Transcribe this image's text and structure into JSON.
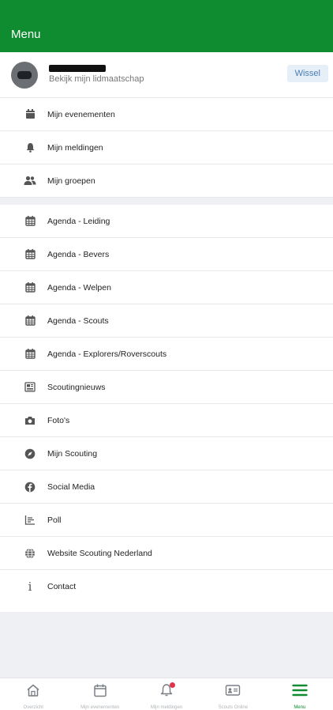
{
  "header": {
    "title": "Menu"
  },
  "member": {
    "subtitle": "Bekijk mijn lidmaatschap",
    "switch_label": "Wissel"
  },
  "group1": [
    {
      "label": "Mijn evenementen",
      "icon": "calendar-icon"
    },
    {
      "label": "Mijn meldingen",
      "icon": "bell-icon"
    },
    {
      "label": "Mijn groepen",
      "icon": "group-icon"
    }
  ],
  "group2": [
    {
      "label": "Agenda - Leiding",
      "icon": "calendar-grid-icon"
    },
    {
      "label": "Agenda - Bevers",
      "icon": "calendar-grid-icon"
    },
    {
      "label": "Agenda - Welpen",
      "icon": "calendar-grid-icon"
    },
    {
      "label": "Agenda - Scouts",
      "icon": "calendar-grid-icon"
    },
    {
      "label": "Agenda - Explorers/Roverscouts",
      "icon": "calendar-grid-icon"
    },
    {
      "label": "Scoutingnieuws",
      "icon": "newspaper-icon"
    },
    {
      "label": "Foto's",
      "icon": "camera-icon"
    },
    {
      "label": "Mijn Scouting",
      "icon": "compass-icon"
    },
    {
      "label": "Social Media",
      "icon": "facebook-icon"
    },
    {
      "label": "Poll",
      "icon": "poll-icon"
    },
    {
      "label": "Website Scouting Nederland",
      "icon": "globe-icon"
    },
    {
      "label": "Contact",
      "icon": "info-icon"
    }
  ],
  "tabbar": [
    {
      "label": "Overzicht",
      "icon": "home-icon"
    },
    {
      "label": "Mijn evenementen",
      "icon": "calendar-icon"
    },
    {
      "label": "Mijn meldingen",
      "icon": "bell-icon"
    },
    {
      "label": "Scouts Online",
      "icon": "id-card-icon"
    },
    {
      "label": "Menu",
      "icon": "hamburger-icon"
    }
  ],
  "colors": {
    "brand_green": "#0e8c2f",
    "accent_blue": "#4a7fb4",
    "badge_red": "#e0344a"
  }
}
